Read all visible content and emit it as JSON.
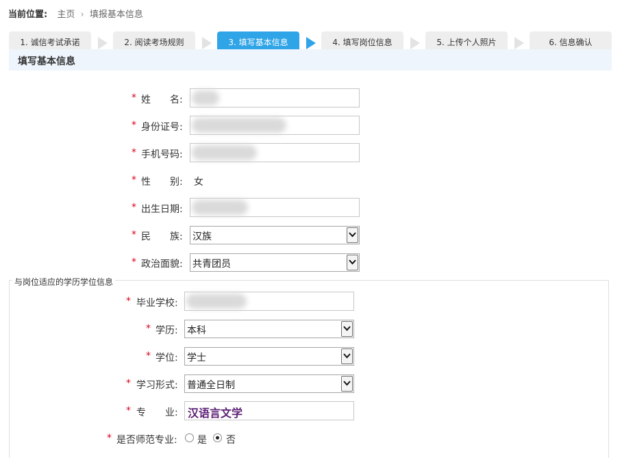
{
  "breadcrumb": {
    "lead": "当前位置:",
    "home": "主页",
    "separator": "›",
    "current": "填报基本信息"
  },
  "steps": [
    {
      "label": "1. 诚信考试承诺",
      "active": false
    },
    {
      "label": "2. 阅读考场规则",
      "active": false
    },
    {
      "label": "3. 填写基本信息",
      "active": true
    },
    {
      "label": "4. 填写岗位信息",
      "active": false
    },
    {
      "label": "5. 上传个人照片",
      "active": false
    },
    {
      "label": "6. 信息确认",
      "active": false
    }
  ],
  "section_title": "填写基本信息",
  "required_mark": "*",
  "basic": {
    "name_label": "姓　　名:",
    "id_label": "身份证号:",
    "phone_label": "手机号码:",
    "gender_label": "性　　别:",
    "gender_value": "女",
    "birth_label": "出生日期:",
    "ethnicity_label": "民　　族:",
    "ethnicity_value": "汉族",
    "political_label": "政治面貌:",
    "political_value": "共青团员"
  },
  "education": {
    "legend": "与岗位适应的学历学位信息",
    "school_label": "毕业学校:",
    "degree_level_label": "学历:",
    "degree_level_value": "本科",
    "degree_label": "学位:",
    "degree_value": "学士",
    "study_form_label": "学习形式:",
    "study_form_value": "普通全日制",
    "major_label": "专　　业:",
    "major_value": "汉语言文学",
    "normal_label": "是否师范专业:",
    "normal_yes": "是",
    "normal_no": "否",
    "normal_selected": "否"
  },
  "icons": {
    "dropdown": "chevron-down-icon",
    "step_arrow": "chevron-right-icon"
  },
  "colors": {
    "active_step": "#2fa4e7",
    "required": "#d9001b",
    "section_bar": "#eef5fc",
    "major_text": "#5b1e74"
  }
}
